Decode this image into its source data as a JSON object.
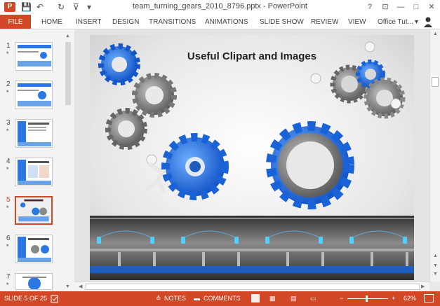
{
  "window": {
    "title": "team_turning_gears_2010_8796.pptx - PowerPoint",
    "help": "?",
    "restore_ribbon": "⊡",
    "minimize": "—",
    "maximize": "□",
    "close": "✕"
  },
  "quick_access": {
    "logo": "P",
    "save": "💾",
    "undo": "↶",
    "redo": "↻",
    "present": "⊽",
    "customize": "▾"
  },
  "ribbon": {
    "tabs": [
      "FILE",
      "HOME",
      "INSERT",
      "DESIGN",
      "TRANSITIONS",
      "ANIMATIONS",
      "SLIDE SHOW",
      "REVIEW",
      "VIEW"
    ],
    "account": "Office Tut...",
    "account_chevron": "▾"
  },
  "thumbnails": [
    {
      "num": "1",
      "star": "*"
    },
    {
      "num": "2",
      "star": "*"
    },
    {
      "num": "3",
      "star": "*"
    },
    {
      "num": "4",
      "star": "*"
    },
    {
      "num": "5",
      "star": "*"
    },
    {
      "num": "6",
      "star": "*"
    },
    {
      "num": "7",
      "star": "*"
    }
  ],
  "slide": {
    "title": "Useful Clipart and Images"
  },
  "status": {
    "slide_indicator": "SLIDE 5 OF 25",
    "notes": "NOTES",
    "comments": "COMMENTS",
    "zoom_minus": "−",
    "zoom_plus": "+",
    "zoom": "62%"
  },
  "colors": {
    "accent": "#d24726",
    "gear_blue": "#2a78e4",
    "gear_gray": "#8a8a8a"
  }
}
